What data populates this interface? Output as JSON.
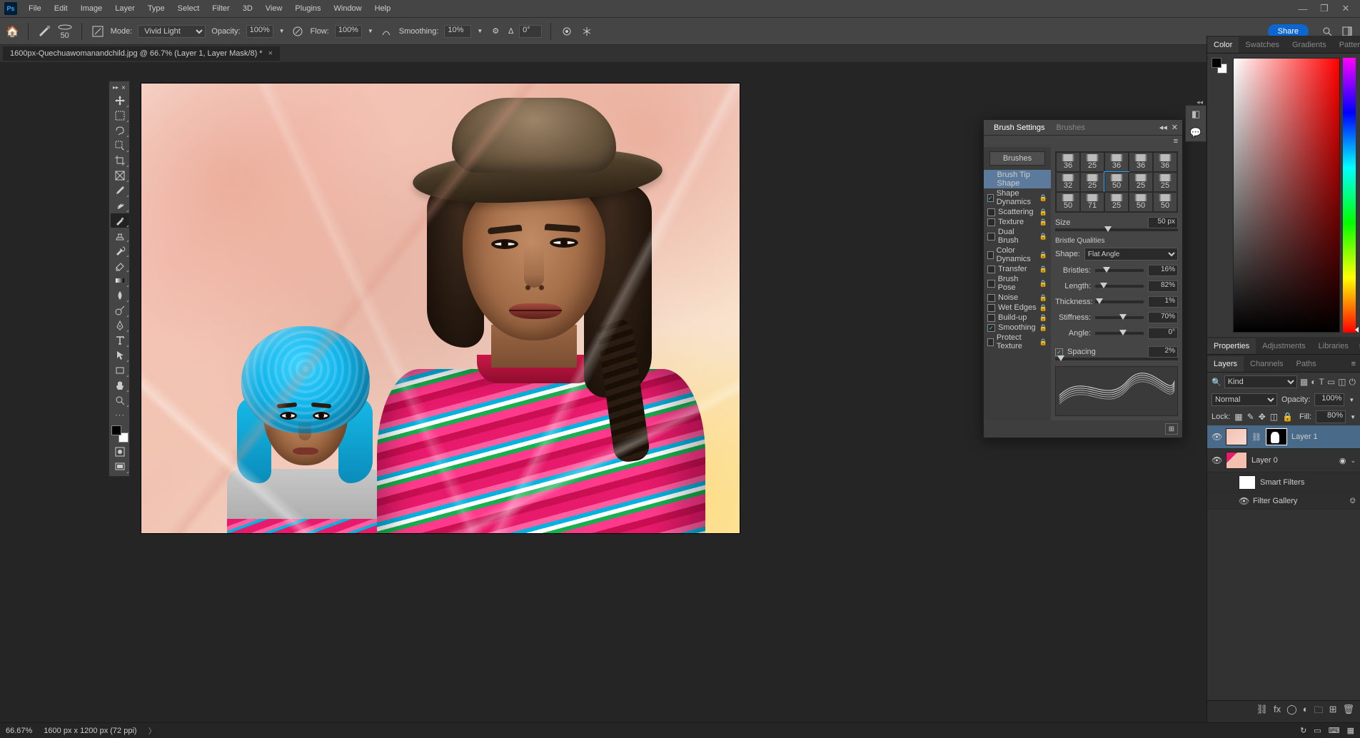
{
  "app": {
    "name": "Photoshop",
    "share_label": "Share"
  },
  "menu": {
    "items": [
      "File",
      "Edit",
      "Image",
      "Layer",
      "Type",
      "Select",
      "Filter",
      "3D",
      "View",
      "Plugins",
      "Window",
      "Help"
    ]
  },
  "options": {
    "brush_size": "50",
    "mode_label": "Mode:",
    "mode_value": "Vivid Light",
    "opacity_label": "Opacity:",
    "opacity_value": "100%",
    "flow_label": "Flow:",
    "flow_value": "100%",
    "smoothing_label": "Smoothing:",
    "smoothing_value": "10%",
    "angle_icon_label": "∆",
    "angle_value": "0°"
  },
  "document": {
    "tab_title": "1600px-Quechuawomanandchild.jpg @ 66.7% (Layer 1, Layer Mask/8) *"
  },
  "status": {
    "zoom": "66.67%",
    "dims": "1600 px x 1200 px (72 ppi)"
  },
  "color_panel": {
    "tabs": [
      "Color",
      "Swatches",
      "Gradients",
      "Patterns"
    ]
  },
  "props_panel": {
    "tabs": [
      "Properties",
      "Adjustments",
      "Libraries"
    ]
  },
  "layers_panel": {
    "tabs": [
      "Layers",
      "Channels",
      "Paths"
    ],
    "kind_label": "Kind",
    "blend_mode": "Normal",
    "opacity_label": "Opacity:",
    "opacity_value": "100%",
    "lock_label": "Lock:",
    "fill_label": "Fill:",
    "fill_value": "80%",
    "items": [
      {
        "name": "Layer 1",
        "visible": true,
        "selected": true,
        "has_mask": true
      },
      {
        "name": "Layer 0",
        "visible": true,
        "smart_object": true
      }
    ],
    "smart_filters_label": "Smart Filters",
    "filter_entry": "Filter Gallery"
  },
  "brush_panel": {
    "tabs": [
      "Brush Settings",
      "Brushes"
    ],
    "brushes_button": "Brushes",
    "tip_shape_label": "Brush Tip Shape",
    "options": [
      {
        "label": "Shape Dynamics",
        "checked": true
      },
      {
        "label": "Scattering",
        "checked": false
      },
      {
        "label": "Texture",
        "checked": false
      },
      {
        "label": "Dual Brush",
        "checked": false
      },
      {
        "label": "Color Dynamics",
        "checked": false
      },
      {
        "label": "Transfer",
        "checked": false
      },
      {
        "label": "Brush Pose",
        "checked": false
      },
      {
        "label": "Noise",
        "checked": false
      },
      {
        "label": "Wet Edges",
        "checked": false
      },
      {
        "label": "Build-up",
        "checked": false
      },
      {
        "label": "Smoothing",
        "checked": true
      },
      {
        "label": "Protect Texture",
        "checked": false
      }
    ],
    "presets": [
      [
        36,
        25,
        36,
        36,
        36
      ],
      [
        32,
        25,
        50,
        25,
        25
      ],
      [
        50,
        71,
        25,
        50,
        50
      ]
    ],
    "selected_preset": "50",
    "size_label": "Size",
    "size_value": "50 px",
    "qualities_label": "Bristle Qualities",
    "shape_label": "Shape:",
    "shape_value": "Flat Angle",
    "bristles_label": "Bristles:",
    "bristles_value": "16%",
    "length_label": "Length:",
    "length_value": "82%",
    "thickness_label": "Thickness:",
    "thickness_value": "1%",
    "stiffness_label": "Stiffness:",
    "stiffness_value": "70%",
    "angle_label": "Angle:",
    "angle_value": "0°",
    "spacing_label": "Spacing",
    "spacing_checked": true,
    "spacing_value": "2%"
  }
}
